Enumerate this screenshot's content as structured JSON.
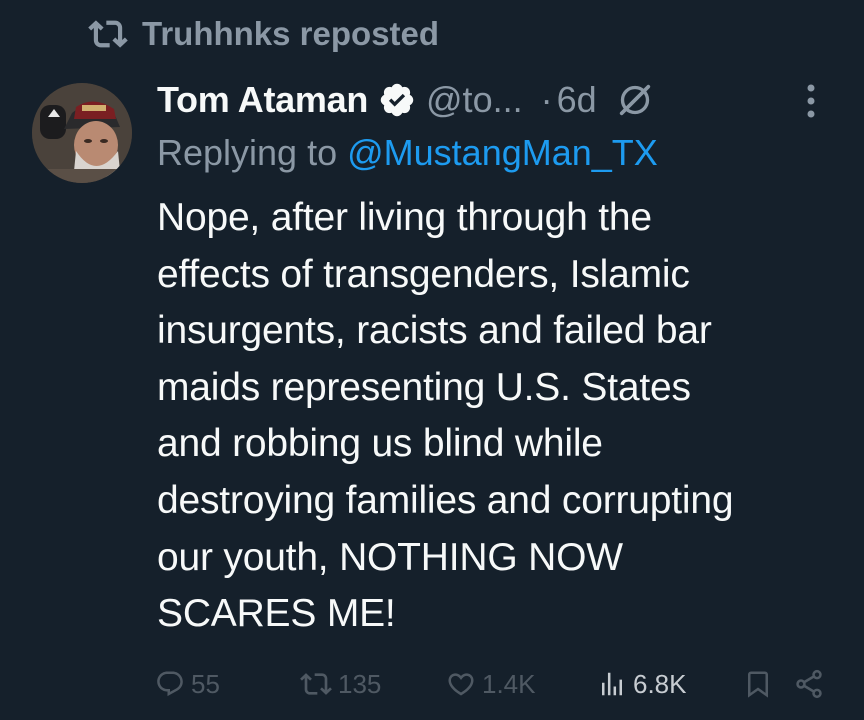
{
  "repost": {
    "icon": "repost-icon",
    "label": "Truhhnks reposted"
  },
  "author": {
    "display_name": "Tom Ataman",
    "verified": true,
    "handle": "@to...",
    "separator": "·",
    "time": "6d"
  },
  "reply_context": {
    "prefix": "Replying to ",
    "mention": "@MustangMan_TX"
  },
  "body": "Nope, after living through the\neffects of transgenders, Islamic\ninsurgents, racists and failed bar\nmaids representing U.S. States\nand robbing us blind while\ndestroying families and corrupting\nour youth, NOTHING NOW\nSCARES ME!",
  "actions": {
    "replies": "55",
    "reposts": "135",
    "likes": "1.4K",
    "views": "6.8K"
  },
  "colors": {
    "background": "#15202b",
    "text": "#f7f9f9",
    "secondary": "#8b98a5",
    "accent": "#1d9bf0",
    "action_muted": "#4f5963"
  }
}
